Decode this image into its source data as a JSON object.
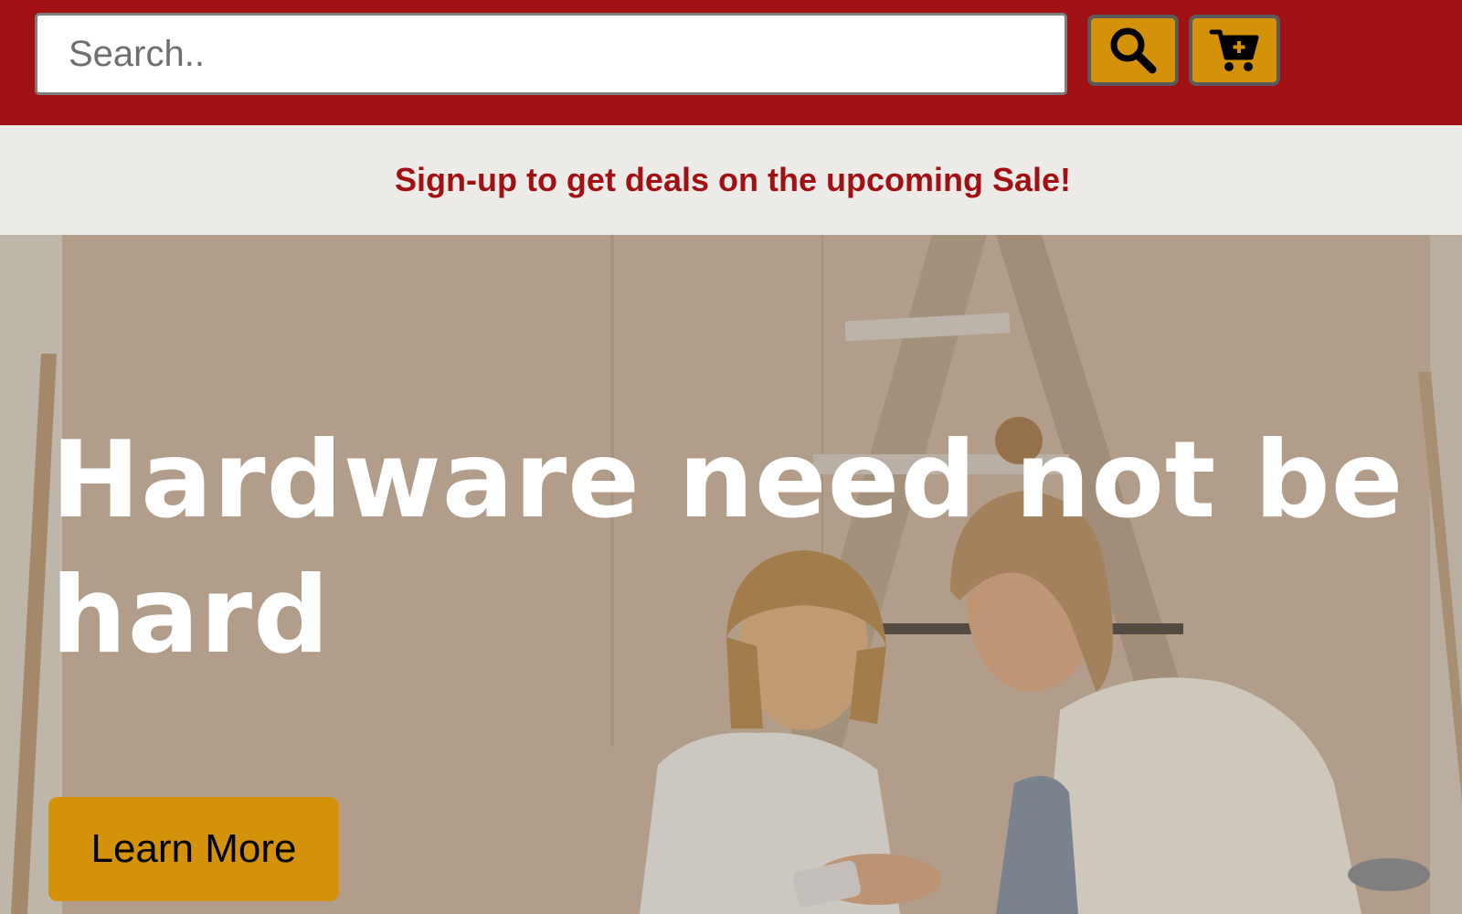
{
  "header": {
    "search_placeholder": "Search..",
    "search_button_icon": "search-icon",
    "cart_button_icon": "cart-add-icon",
    "background_color": "#a11114",
    "button_color": "#d4920a"
  },
  "promo": {
    "text": "Sign-up to get deals on the upcoming Sale!",
    "text_color": "#a11114",
    "background_color": "#ecebe8"
  },
  "hero": {
    "title": "Hardware need not be hard",
    "cta_label": "Learn More",
    "cta_color": "#d4920a"
  }
}
